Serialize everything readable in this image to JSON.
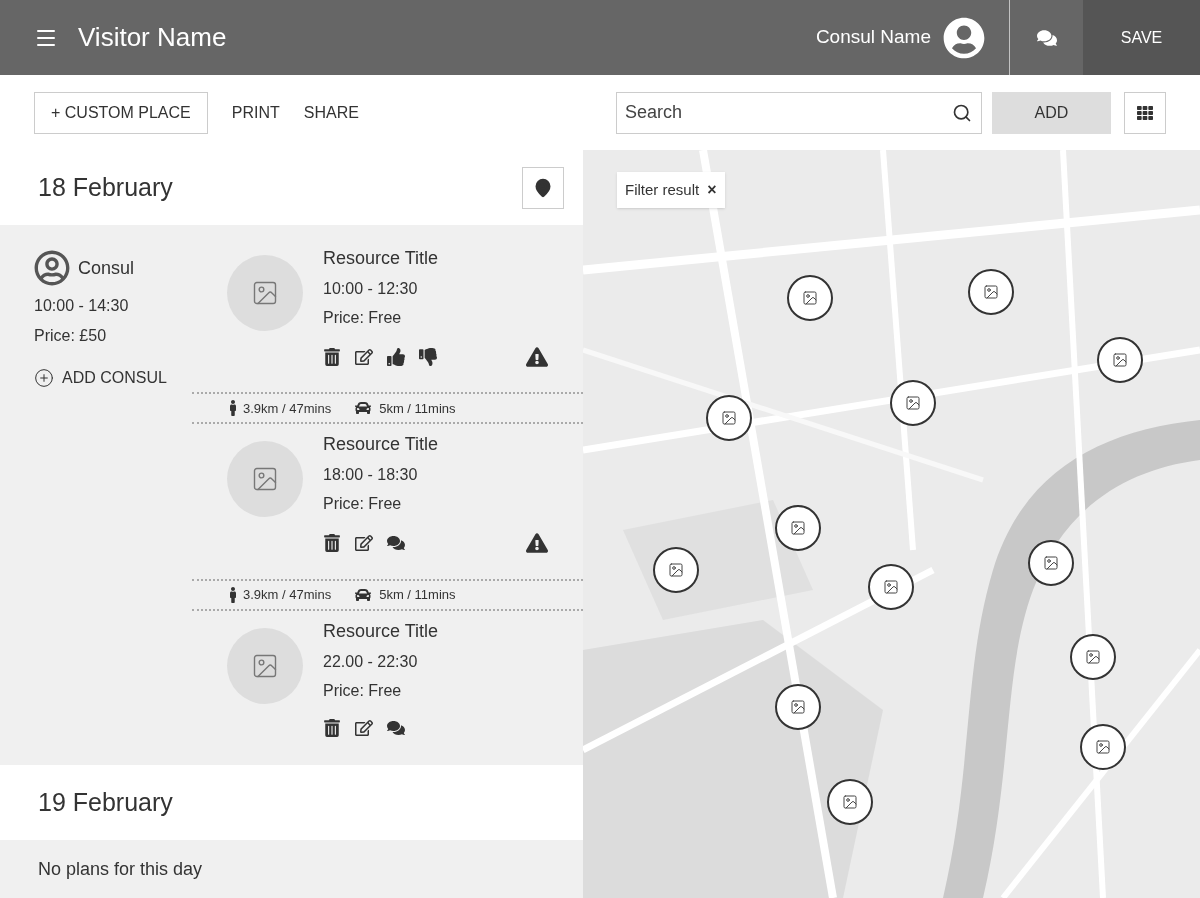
{
  "header": {
    "title": "Visitor Name",
    "user": "Consul Name",
    "save": "SAVE"
  },
  "toolbar": {
    "custom_place": "+ CUSTOM PLACE",
    "print": "PRINT",
    "share": "SHARE",
    "search": {
      "placeholder": "Search"
    },
    "add": "ADD"
  },
  "days": [
    {
      "date": "18 February",
      "consul": {
        "name": "Consul",
        "time": "10:00 - 14:30",
        "price": "Price: £50",
        "add": "ADD CONSUL"
      },
      "items": [
        {
          "kind": "resource",
          "title": "Resource Title",
          "time": "10:00 - 12:30",
          "price": "Price: Free",
          "actions": [
            {
              "kind": "delete"
            },
            {
              "kind": "edit"
            },
            {
              "kind": "like"
            },
            {
              "kind": "dislike"
            }
          ],
          "warning": true
        },
        {
          "kind": "travel",
          "walk": "3.9km / 47mins",
          "drive": "5km / 11mins"
        },
        {
          "kind": "resource",
          "title": "Resource Title",
          "time": "18:00 - 18:30",
          "price": "Price: Free",
          "actions": [
            {
              "kind": "delete"
            },
            {
              "kind": "edit"
            },
            {
              "kind": "comment"
            }
          ],
          "warning": true
        },
        {
          "kind": "travel",
          "walk": "3.9km / 47mins",
          "drive": "5km / 11mins"
        },
        {
          "kind": "resource",
          "title": "Resource Title",
          "time": "22.00 - 22:30",
          "price": "Price: Free",
          "actions": [
            {
              "kind": "delete"
            },
            {
              "kind": "edit"
            },
            {
              "kind": "comment"
            }
          ],
          "warning": false
        }
      ]
    },
    {
      "date": "19 February",
      "empty": "No plans for this day"
    }
  ],
  "map": {
    "filter": {
      "label": "Filter result",
      "close": "×"
    }
  }
}
